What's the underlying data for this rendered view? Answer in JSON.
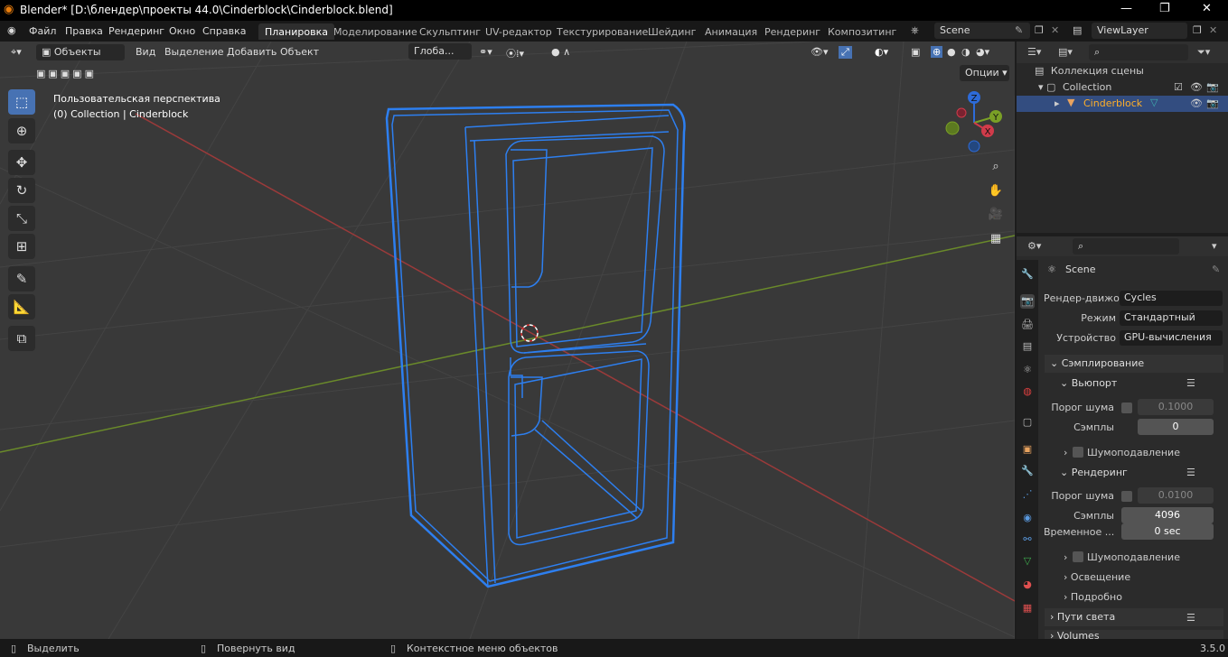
{
  "window": {
    "title": "Blender* [D:\\блендер\\проекты 44.0\\Cinderblock\\Cinderblock.blend]"
  },
  "menu": [
    "Файл",
    "Правка",
    "Рендеринг",
    "Окно",
    "Справка"
  ],
  "workspaces": [
    "Планировка",
    "Моделирование",
    "Скульптинг",
    "UV-редактор",
    "Текстурирование",
    "Шейдинг",
    "Анимация",
    "Рендеринг",
    "Композитинг"
  ],
  "scene": {
    "name": "Scene",
    "view_layer": "ViewLayer"
  },
  "viewport": {
    "mode": "Объекты",
    "menus": [
      "Вид",
      "Выделение",
      "Добавить",
      "Объект"
    ],
    "transform": "Глоба...",
    "options": "Опции",
    "overlay_title": "Пользовательская перспектива",
    "overlay_sub": "(0) Collection | Cinderblock",
    "axes": {
      "z": "Z",
      "y": "Y",
      "x": "X"
    }
  },
  "outliner": {
    "root": "Коллекция сцены",
    "collection": "Collection",
    "object": "Cinderblock"
  },
  "properties": {
    "scene": "Scene",
    "render_engine_label": "Рендер-движок",
    "render_engine": "Cycles",
    "mode_label": "Режим",
    "mode": "Стандартный",
    "device_label": "Устройство",
    "device": "GPU-вычисления",
    "sampling": "Сэмплирование",
    "viewport": "Вьюпорт",
    "noise_label": "Порог шума",
    "vp_noise": "0.1000",
    "samples_label": "Сэмплы",
    "vp_samples": "0",
    "denoise": "Шумоподавление",
    "render": "Рендеринг",
    "r_noise": "0.0100",
    "r_samples": "4096",
    "time_label": "Временное ...",
    "time": "0 sec",
    "lights": "Освещение",
    "advanced": "Подробно",
    "light_paths": "Пути света",
    "volumes": "Volumes"
  },
  "status": {
    "select": "Выделить",
    "rotate": "Повернуть вид",
    "context": "Контекстное меню объектов",
    "version": "3.5.0"
  }
}
